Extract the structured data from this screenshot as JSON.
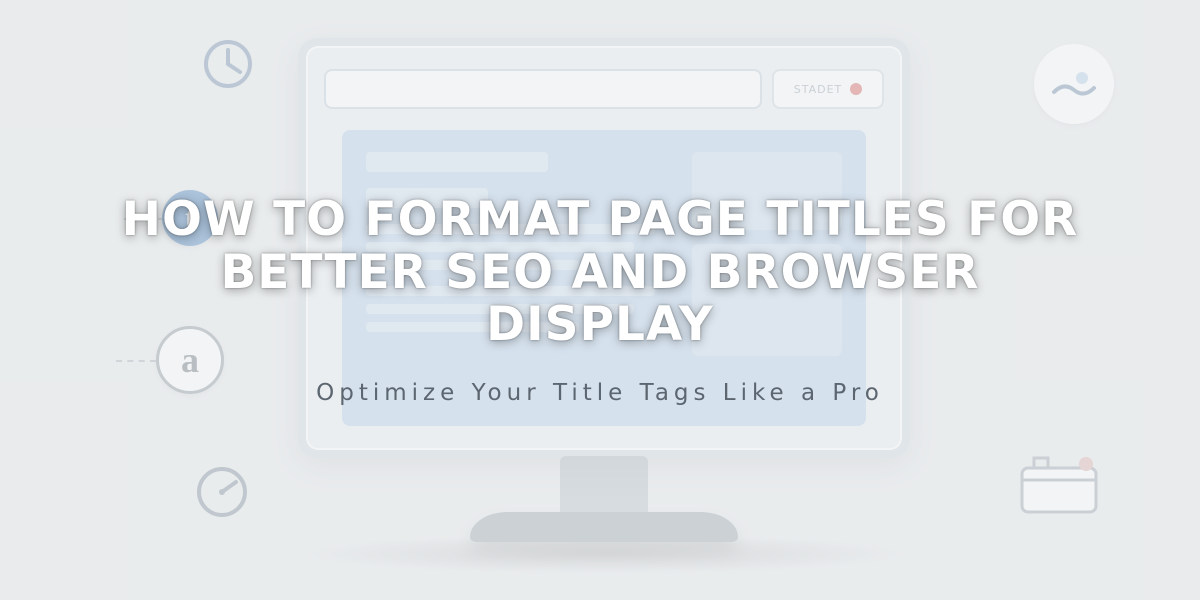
{
  "hero": {
    "title": "HOW TO FORMAT PAGE TITLES FOR BETTER SEO AND BROWSER DISPLAY",
    "subtitle": "Optimize Your Title Tags Like a Pro"
  },
  "browser": {
    "pill_label": "STADET"
  },
  "icons": {
    "t_letter": "t",
    "a_letter": "a"
  }
}
